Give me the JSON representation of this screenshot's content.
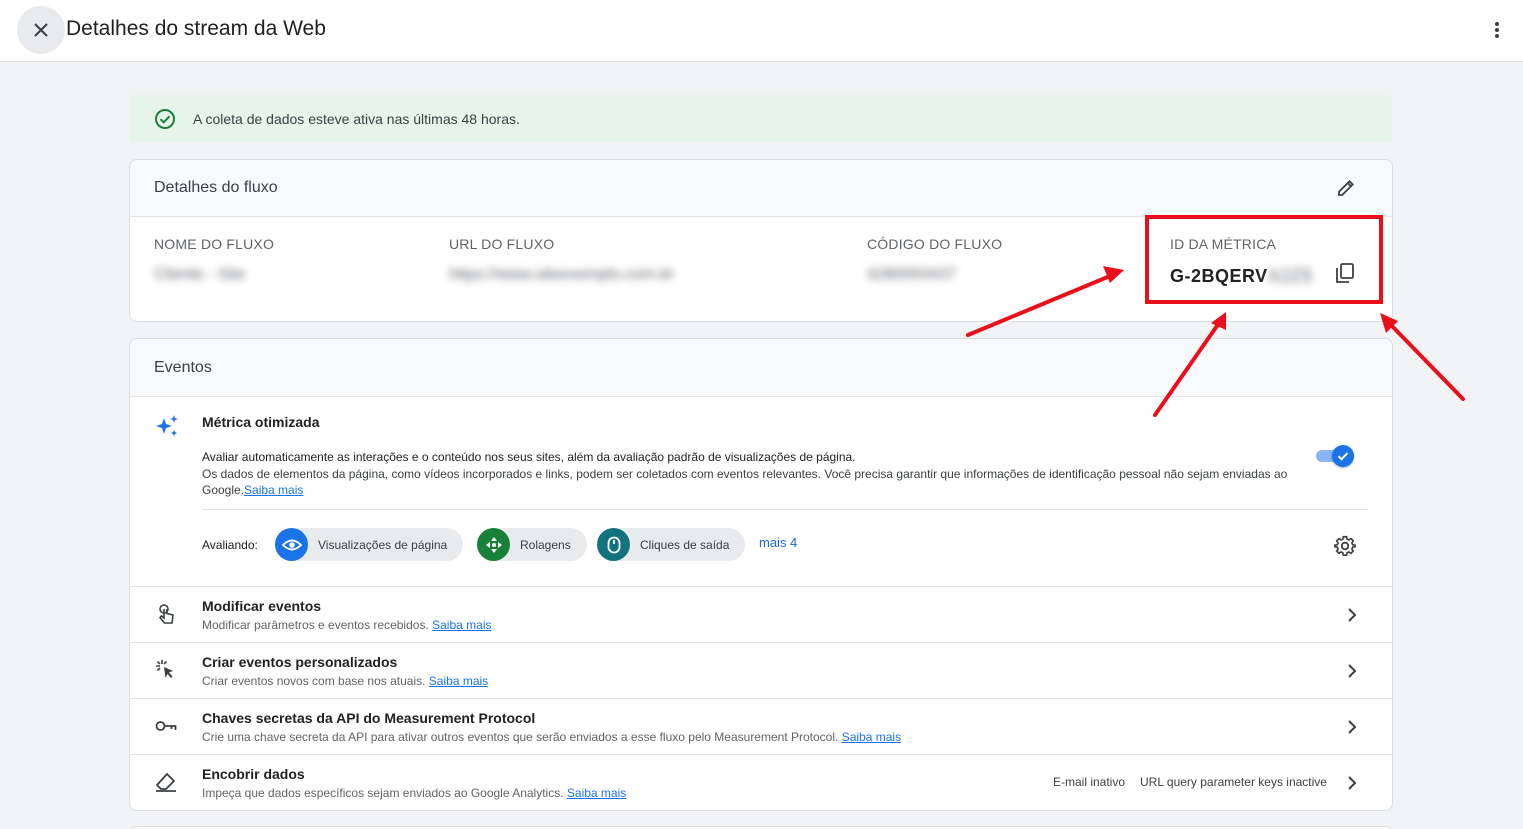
{
  "header": {
    "title": "Detalhes do stream da Web"
  },
  "banner": {
    "text": "A coleta de dados esteve ativa nas últimas 48 horas."
  },
  "stream": {
    "section_title": "Detalhes do fluxo",
    "fields": [
      {
        "label": "NOME DO FLUXO",
        "value": "Cliente - Site"
      },
      {
        "label": "URL DO FLUXO",
        "value": "https://www.siteexemplo.com.br"
      },
      {
        "label": "CÓDIGO DO FLUXO",
        "value": "4280093437"
      },
      {
        "label": "ID DA MÉTRICA",
        "value_visible": "G-2BQERV",
        "value_hidden": "X2Z5"
      }
    ]
  },
  "events": {
    "section_title": "Eventos",
    "optimized": {
      "title": "Métrica otimizada",
      "desc1": "Avaliar automaticamente as interações e o conteúdo nos seus sites, além da avaliação padrão de visualizações de página.",
      "desc2": "Os dados de elementos da página, como vídeos incorporados e links, podem ser coletados com eventos relevantes. Você precisa garantir que informações de identificação pessoal não sejam enviadas ao Google.",
      "learn_more": "Saiba mais",
      "toggle_on": true,
      "evaluating_label": "Avaliando:",
      "chips": [
        {
          "label": "Visualizações de página",
          "icon": "eye-icon",
          "color": "#1a73e8"
        },
        {
          "label": "Rolagens",
          "icon": "crosshair-icon",
          "color": "#188038"
        },
        {
          "label": "Cliques de saída",
          "icon": "mouse-icon",
          "color": "#12727d"
        }
      ],
      "more": "mais 4"
    },
    "rows": [
      {
        "title": "Modificar eventos",
        "desc": "Modificar parâmetros e eventos recebidos.",
        "link": "Saiba mais",
        "icon": "touch-icon"
      },
      {
        "title": "Criar eventos personalizados",
        "desc": "Criar eventos novos com base nos atuais.",
        "link": "Saiba mais",
        "icon": "click-sparkle-icon"
      },
      {
        "title": "Chaves secretas da API do Measurement Protocol",
        "desc": "Crie uma chave secreta da API para ativar outros eventos que serão enviados a esse fluxo pelo Measurement Protocol.",
        "link": "Saiba mais",
        "icon": "key-icon"
      },
      {
        "title": "Encobrir dados",
        "desc": "Impeça que dados específicos sejam enviados ao Google Analytics.",
        "link": "Saiba mais",
        "icon": "eraser-icon",
        "tags": [
          "E-mail inativo",
          "URL query parameter keys inactive"
        ]
      }
    ]
  },
  "colors": {
    "accent": "#1a73e8",
    "success": "#188038",
    "annotation": "#e8101a"
  }
}
